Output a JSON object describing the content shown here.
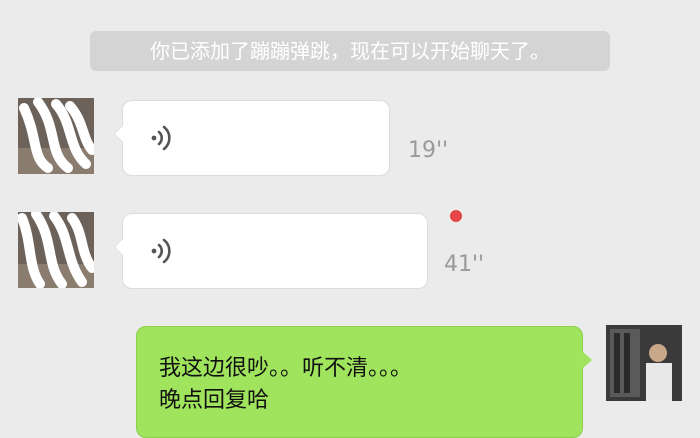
{
  "system_notice": "你已添加了蹦蹦弹跳，现在可以开始聊天了。",
  "messages": [
    {
      "type": "voice",
      "direction": "incoming",
      "duration": "19''",
      "unread": false,
      "icon": "voice-wave-icon"
    },
    {
      "type": "voice",
      "direction": "incoming",
      "duration": "41''",
      "unread": true,
      "icon": "voice-wave-icon"
    },
    {
      "type": "text",
      "direction": "outgoing",
      "lines": [
        "我这边很吵。。听不清。。。",
        "晚点回复哈"
      ]
    }
  ],
  "colors": {
    "background": "#ebebeb",
    "incoming_bubble": "#ffffff",
    "outgoing_bubble": "#9fe45c",
    "unread_dot": "#e64545",
    "duration_text": "#9a9a9a"
  }
}
